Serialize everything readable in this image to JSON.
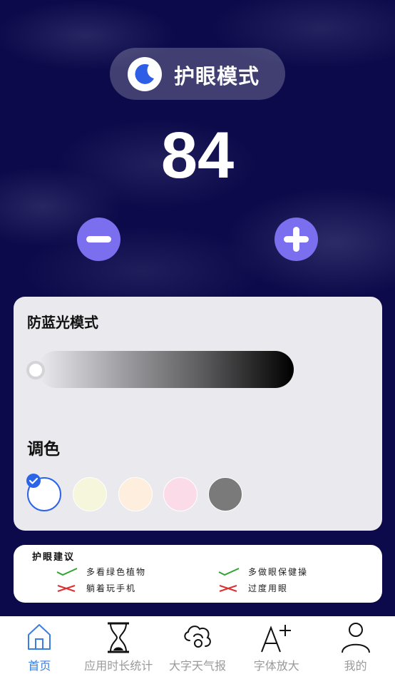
{
  "header": {
    "mode_title": "护眼模式",
    "icon": "moon-icon"
  },
  "value": {
    "current": "84",
    "minus_icon": "minus-icon",
    "plus_icon": "plus-icon"
  },
  "panel": {
    "bluelight_label": "防蓝光模式",
    "color_label": "调色",
    "swatches": [
      "#ffffff",
      "#f6f6dc",
      "#fdeedd",
      "#fcdbe8",
      "#7a7a7a"
    ],
    "selected_swatch": 0,
    "slider_level": 0
  },
  "tips": {
    "title": "护眼建议",
    "do": [
      "多看绿色植物",
      "多做眼保健操"
    ],
    "dont": [
      "躺着玩手机",
      "过度用眼"
    ],
    "do_color": "#2fa52f",
    "dont_color": "#d93030"
  },
  "tabbar": {
    "items": [
      {
        "label": "首页",
        "icon": "home-icon",
        "active": true
      },
      {
        "label": "应用时长统计",
        "icon": "hourglass-icon",
        "active": false
      },
      {
        "label": "大字天气报",
        "icon": "weather-icon",
        "active": false
      },
      {
        "label": "字体放大",
        "icon": "font-size-icon",
        "active": false
      },
      {
        "label": "我的",
        "icon": "profile-icon",
        "active": false
      }
    ],
    "active_color": "#3b7de0"
  }
}
